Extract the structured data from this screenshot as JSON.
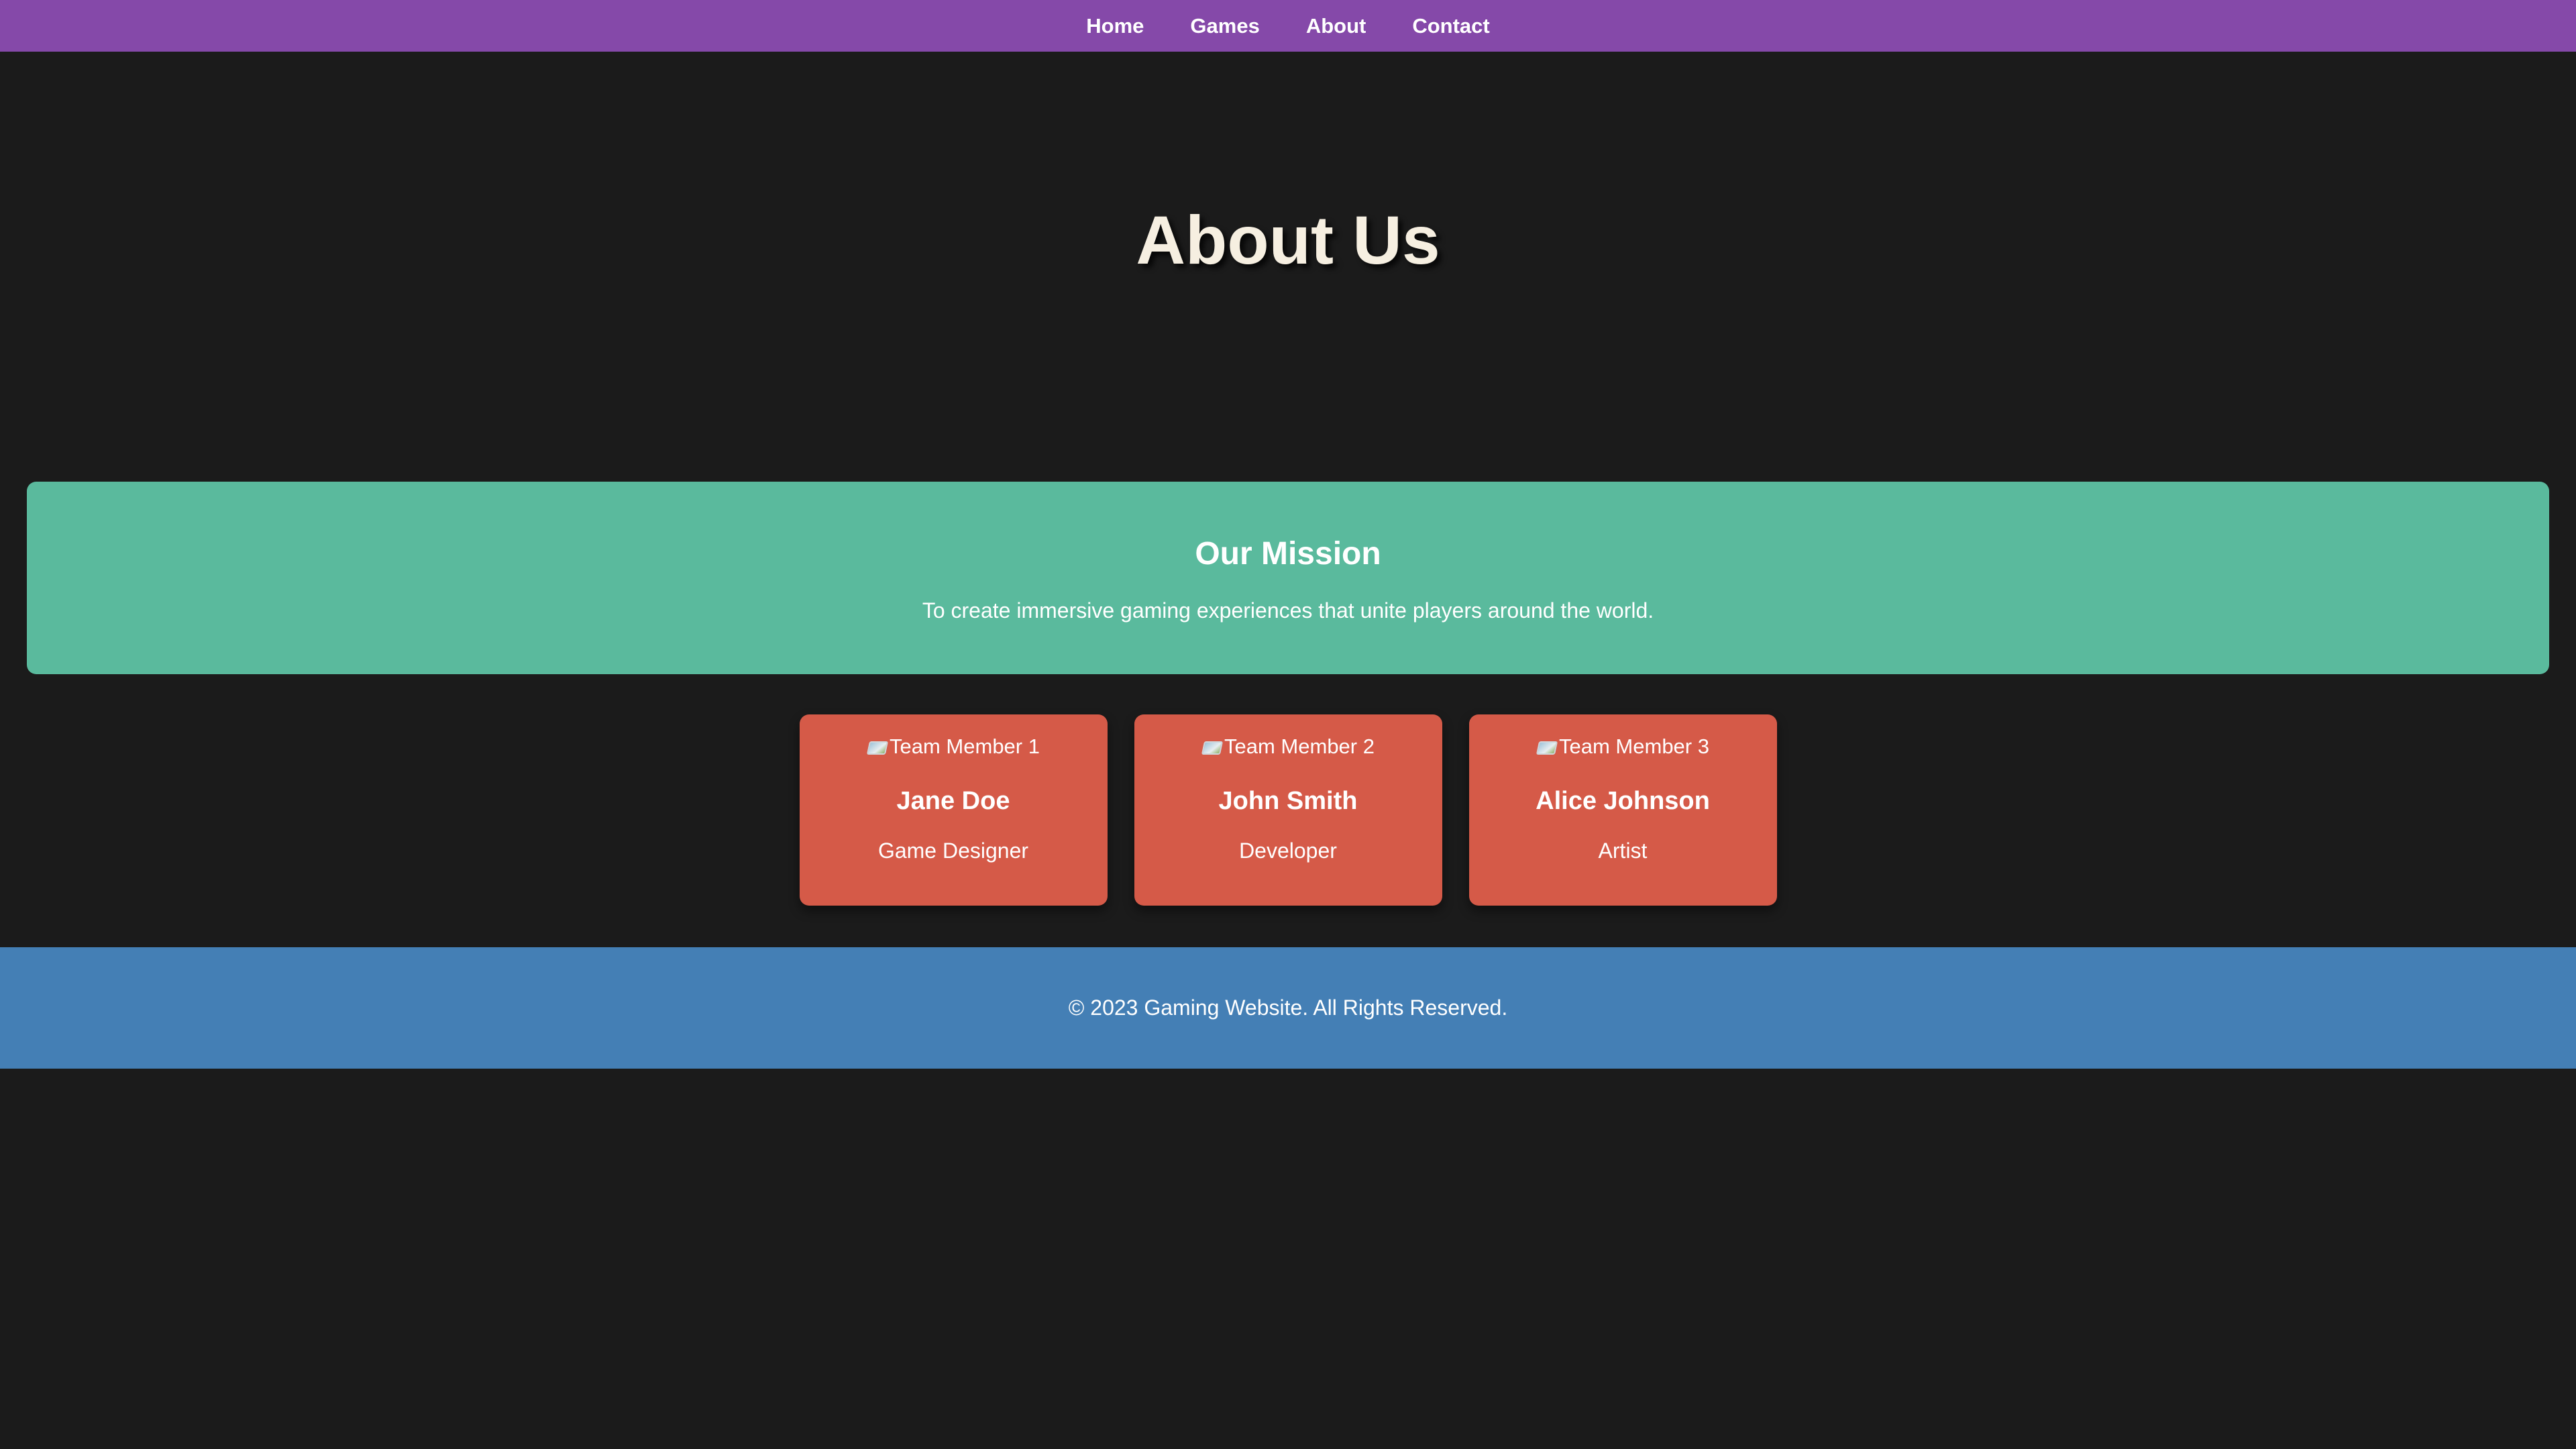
{
  "nav": {
    "items": [
      {
        "label": "Home"
      },
      {
        "label": "Games"
      },
      {
        "label": "About"
      },
      {
        "label": "Contact"
      }
    ]
  },
  "hero": {
    "title": "About Us"
  },
  "mission": {
    "title": "Our Mission",
    "text": "To create immersive gaming experiences that unite players around the world."
  },
  "team": {
    "members": [
      {
        "image_alt": "Team Member 1",
        "name": "Jane Doe",
        "role": "Game Designer"
      },
      {
        "image_alt": "Team Member 2",
        "name": "John Smith",
        "role": "Developer"
      },
      {
        "image_alt": "Team Member 3",
        "name": "Alice Johnson",
        "role": "Artist"
      }
    ]
  },
  "footer": {
    "text": "© 2023 Gaming Website. All Rights Reserved."
  },
  "colors": {
    "nav_bg": "#8549a9",
    "page_bg": "#1b1b1b",
    "mission_bg": "#5aba9d",
    "card_bg": "#d55a48",
    "footer_bg": "#447fb5",
    "hero_title": "#f6efe1"
  }
}
